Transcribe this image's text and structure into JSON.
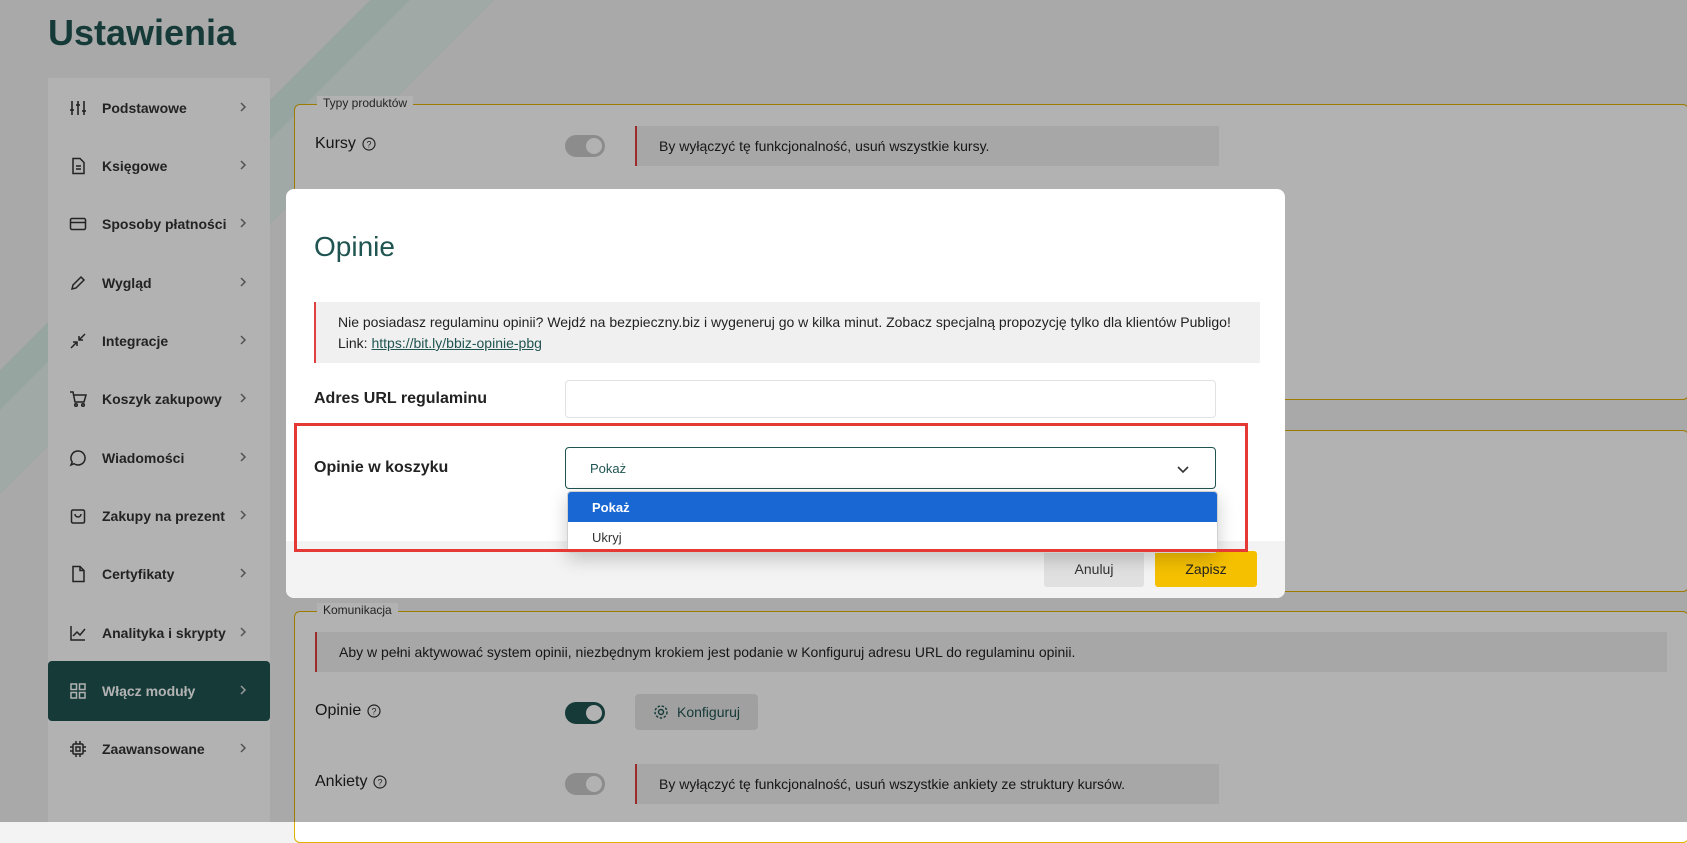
{
  "page": {
    "title": "Ustawienia"
  },
  "sidebar": {
    "items": [
      {
        "label": "Podstawowe",
        "icon": "sliders-icon"
      },
      {
        "label": "Księgowe",
        "icon": "document-icon"
      },
      {
        "label": "Sposoby płatności",
        "icon": "credit-card-icon"
      },
      {
        "label": "Wygląd",
        "icon": "pencil-icon"
      },
      {
        "label": "Integracje",
        "icon": "arrows-in-icon"
      },
      {
        "label": "Koszyk zakupowy",
        "icon": "cart-icon"
      },
      {
        "label": "Wiadomości",
        "icon": "chat-icon"
      },
      {
        "label": "Zakupy na prezent",
        "icon": "gift-bag-icon"
      },
      {
        "label": "Certyfikaty",
        "icon": "certificate-icon"
      },
      {
        "label": "Analityka i skrypty",
        "icon": "chart-line-icon"
      },
      {
        "label": "Włącz moduły",
        "icon": "grid-icon",
        "active": true
      },
      {
        "label": "Zaawansowane",
        "icon": "chip-icon"
      }
    ]
  },
  "background": {
    "product_types": {
      "legend": "Typy produktów",
      "kursy_label": "Kursy",
      "kursy_notice": "By wyłączyć tę funkcjonalność, usuń wszystkie kursy."
    },
    "communication": {
      "legend": "Komunikacja",
      "notice": "Aby w pełni aktywować system opinii, niezbędnym krokiem jest podanie w Konfiguruj adresu URL do regulaminu opinii.",
      "opinie_label": "Opinie",
      "configure_label": "Konfiguruj",
      "ankiety_label": "Ankiety",
      "ankiety_notice": "By wyłączyć tę funkcjonalność, usuń wszystkie ankiety ze struktury kursów."
    }
  },
  "modal": {
    "title": "Opinie",
    "info_text": "Nie posiadasz regulaminu opinii? Wejdź na bezpieczny.biz i wygeneruj go w kilka minut. Zobacz specjalną propozycję tylko dla klientów Publigo!",
    "info_link_prefix": "Link: ",
    "info_link": "https://bit.ly/bbiz-opinie-pbg",
    "url_label": "Adres URL regulaminu",
    "url_value": "",
    "cart_label": "Opinie w koszyku",
    "select_value": "Pokaż",
    "options": [
      "Pokaż",
      "Ukryj"
    ],
    "cancel_label": "Anuluj",
    "save_label": "Zapisz"
  },
  "colors": {
    "brand": "#1f5451",
    "accent_yellow": "#f5c000",
    "highlight_red": "#e53935",
    "selected_blue": "#1967d2"
  }
}
